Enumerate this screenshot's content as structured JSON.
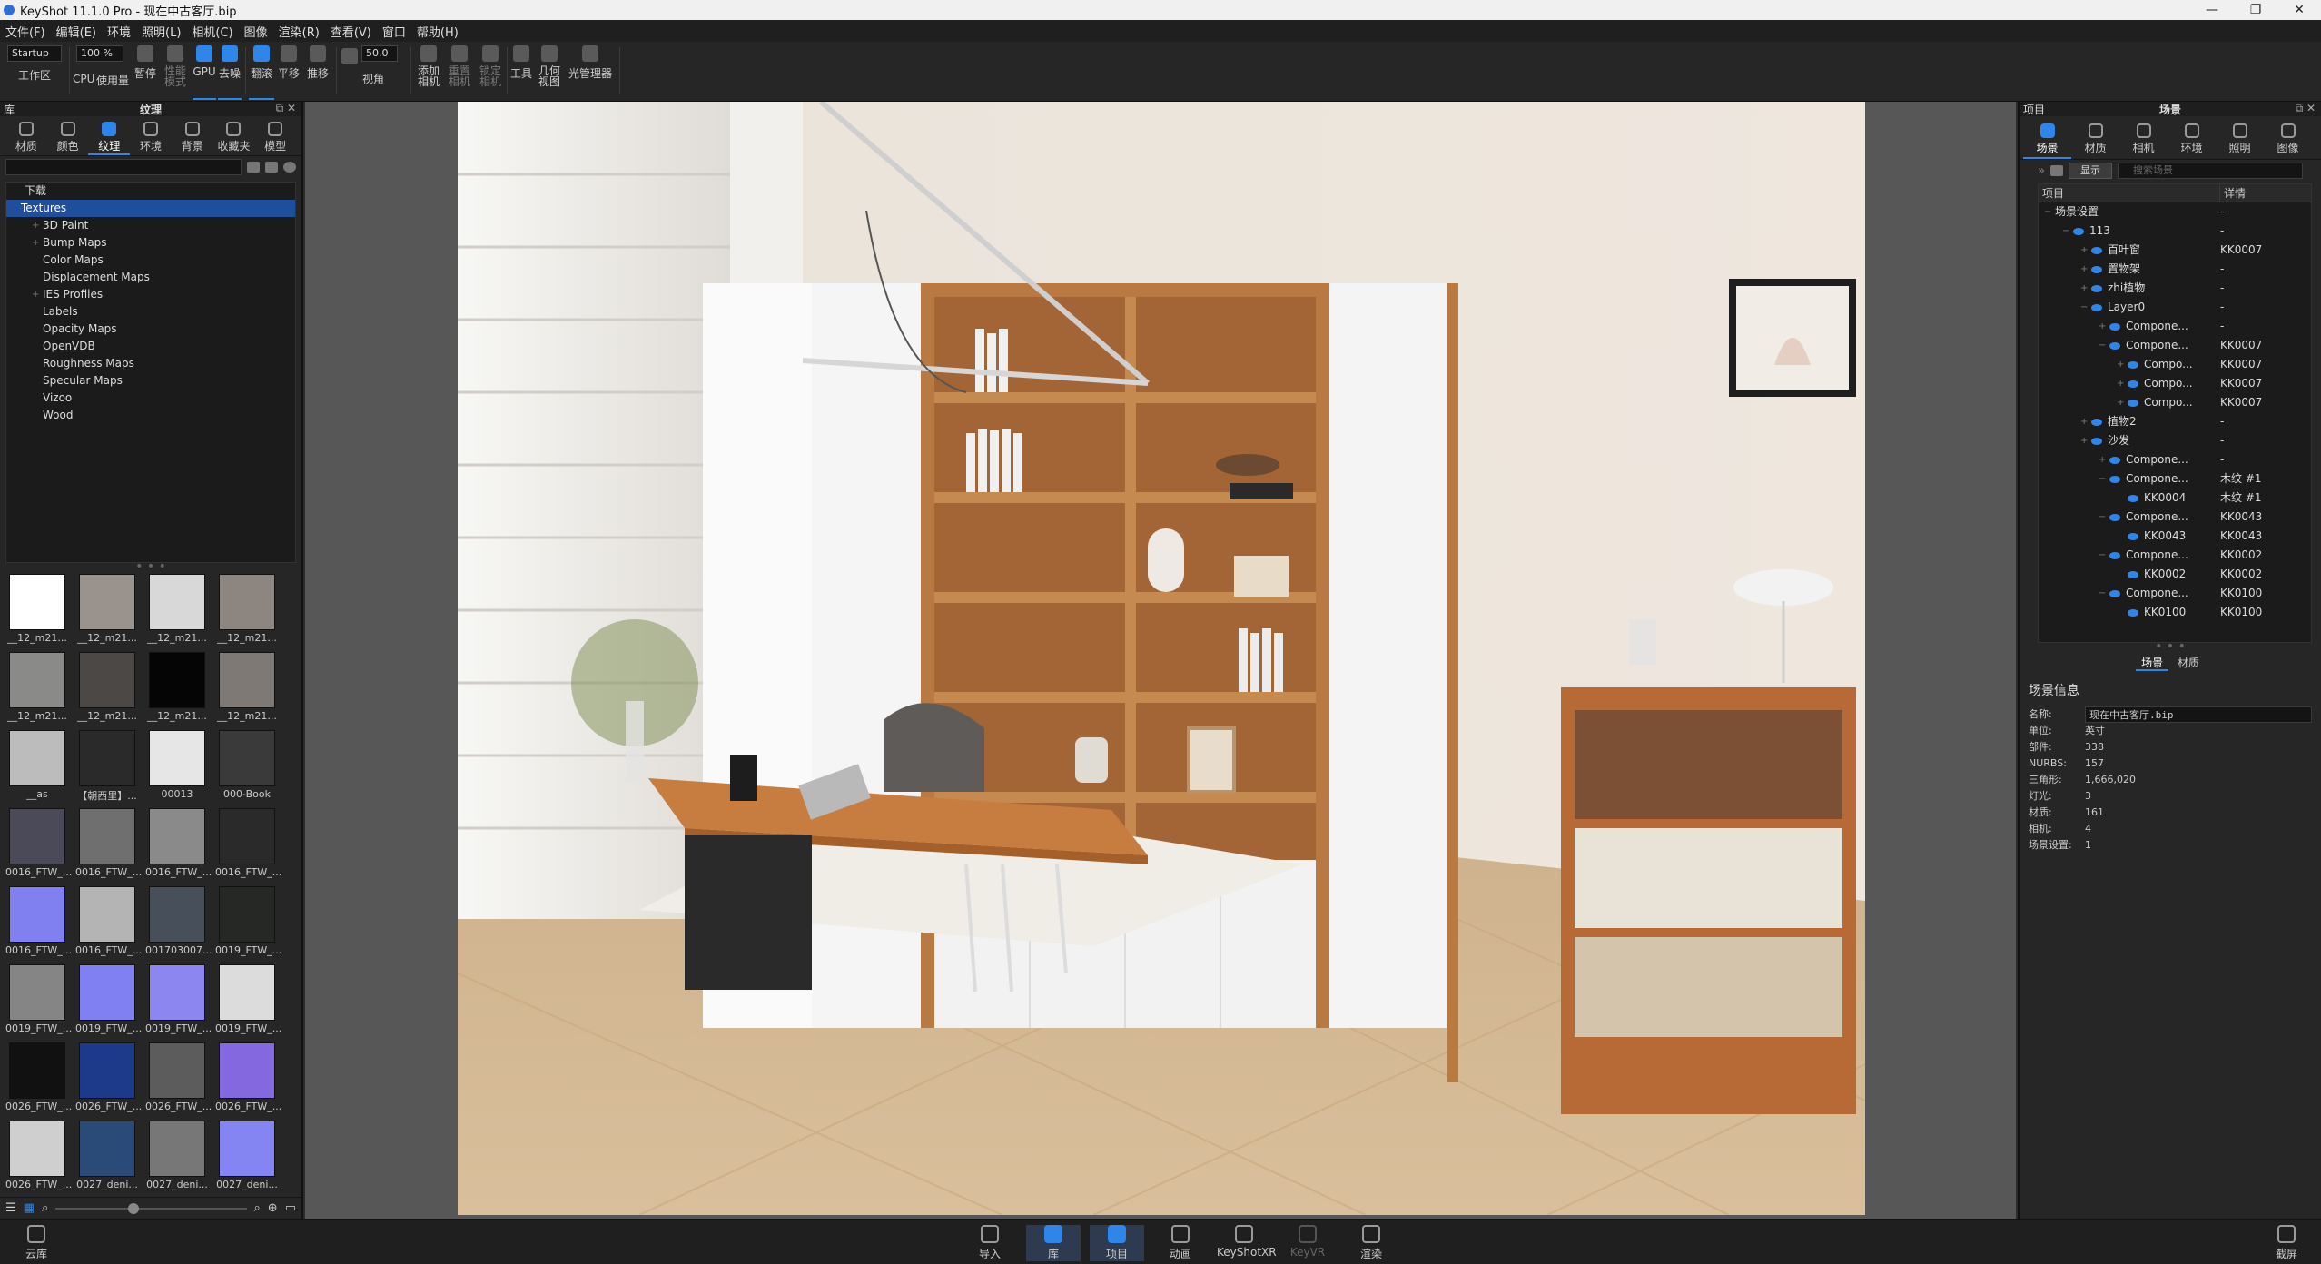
{
  "window": {
    "title": "KeyShot 11.1.0 Pro  - 现在中古客厅.bip",
    "controls": [
      "—",
      "❐",
      "✕"
    ]
  },
  "menu": [
    "文件(F)",
    "编辑(E)",
    "环境",
    "照明(L)",
    "相机(C)",
    "图像",
    "渲染(R)",
    "查看(V)",
    "窗口",
    "帮助(H)"
  ],
  "toolbar": {
    "workspace_value": "Startup",
    "workspace_label": "工作区",
    "zoom_value": "100 %",
    "cpu_label": "CPU",
    "usage_label": "使用量",
    "pause_label": "暂停",
    "perf_label": "性能\n模式",
    "gpu_label": "GPU",
    "denoise_label": "去噪",
    "tumble_label": "翻滚",
    "pan_label": "平移",
    "dolly_label": "推移",
    "fov_value": "50.0",
    "fov_label": "视角",
    "add_camera": "添加\n相机",
    "reset_camera": "重置\n相机",
    "lock_camera": "锁定\n相机",
    "tools": "工具",
    "geometry_view": "几何\n视图",
    "light_manager": "光管理器"
  },
  "left_panel": {
    "header_left": "库",
    "header_center": "纹理",
    "tabs": [
      "材质",
      "颜色",
      "纹理",
      "环境",
      "背景",
      "收藏夹",
      "模型"
    ],
    "active_tab": "纹理",
    "tree": [
      {
        "label": "下载",
        "type": "root"
      },
      {
        "label": "Textures",
        "type": "selected"
      },
      {
        "label": "3D Paint",
        "type": "child",
        "expand": true
      },
      {
        "label": "Bump Maps",
        "type": "child",
        "expand": true
      },
      {
        "label": "Color Maps",
        "type": "child"
      },
      {
        "label": "Displacement Maps",
        "type": "child"
      },
      {
        "label": "IES Profiles",
        "type": "child",
        "expand": true
      },
      {
        "label": "Labels",
        "type": "child"
      },
      {
        "label": "Opacity Maps",
        "type": "child"
      },
      {
        "label": "OpenVDB",
        "type": "child"
      },
      {
        "label": "Roughness Maps",
        "type": "child"
      },
      {
        "label": "Specular Maps",
        "type": "child"
      },
      {
        "label": "Vizoo",
        "type": "child"
      },
      {
        "label": "Wood",
        "type": "child"
      }
    ],
    "thumbnails": [
      {
        "label": "__12_m21...",
        "color": "#ffffff"
      },
      {
        "label": "__12_m21...",
        "color": "#9a938d"
      },
      {
        "label": "__12_m21...",
        "color": "#d8d8d8"
      },
      {
        "label": "__12_m21...",
        "color": "#8d8580"
      },
      {
        "label": "__12_m21...",
        "color": "#8a8a88"
      },
      {
        "label": "__12_m21...",
        "color": "#4b4845"
      },
      {
        "label": "__12_m21...",
        "color": "#050505"
      },
      {
        "label": "__12_m21...",
        "color": "#7e7974"
      },
      {
        "label": "__as",
        "color": "#bcbcbc"
      },
      {
        "label": "【朝西里】...",
        "color": "#2a2a2a"
      },
      {
        "label": "00013",
        "color": "#e6e6e6"
      },
      {
        "label": "000-Book",
        "color": "#3a3a3a"
      },
      {
        "label": "0016_FTW_...",
        "color": "#4a4a58"
      },
      {
        "label": "0016_FTW_...",
        "color": "#6f6f6f"
      },
      {
        "label": "0016_FTW_...",
        "color": "#8a8a8a"
      },
      {
        "label": "0016_FTW_...",
        "color": "#2a2a2a"
      },
      {
        "label": "0016_FTW_...",
        "color": "#8080f0"
      },
      {
        "label": "0016_FTW_...",
        "color": "#b4b4b4"
      },
      {
        "label": "001703007...",
        "color": "#47505a"
      },
      {
        "label": "0019_FTW_...",
        "color": "#262826"
      },
      {
        "label": "0019_FTW_...",
        "color": "#858585"
      },
      {
        "label": "0019_FTW_...",
        "color": "#8080f2"
      },
      {
        "label": "0019_FTW_...",
        "color": "#8c86f0"
      },
      {
        "label": "0019_FTW_...",
        "color": "#dcdcdc"
      },
      {
        "label": "0026_FTW_...",
        "color": "#111111"
      },
      {
        "label": "0026_FTW_...",
        "color": "#1d3a8a"
      },
      {
        "label": "0026_FTW_...",
        "color": "#5c5c5c"
      },
      {
        "label": "0026_FTW_...",
        "color": "#8468e0"
      },
      {
        "label": "0026_FTW_...",
        "color": "#cfcfcf"
      },
      {
        "label": "0027_deni...",
        "color": "#2a4a78"
      },
      {
        "label": "0027_deni...",
        "color": "#777777"
      },
      {
        "label": "0027_deni...",
        "color": "#8484f2"
      }
    ]
  },
  "right_panel": {
    "header_left": "项目",
    "header_center": "场景",
    "tabs": [
      "场景",
      "材质",
      "相机",
      "环境",
      "照明",
      "图像"
    ],
    "active_tab": "场景",
    "show_button": "显示",
    "search_placeholder": "搜索场景",
    "col_item": "项目",
    "col_detail": "详情",
    "tree": [
      {
        "name": "场景设置",
        "detail": "-",
        "indent": 0,
        "toggle": "−",
        "eye": false
      },
      {
        "name": "113",
        "detail": "-",
        "indent": 1,
        "toggle": "−",
        "eye": true
      },
      {
        "name": "百叶窗",
        "detail": "KK0007",
        "indent": 2,
        "toggle": "+",
        "eye": true
      },
      {
        "name": "置物架",
        "detail": "-",
        "indent": 2,
        "toggle": "+",
        "eye": true
      },
      {
        "name": "zhi植物",
        "detail": "-",
        "indent": 2,
        "toggle": "+",
        "eye": true
      },
      {
        "name": "Layer0",
        "detail": "-",
        "indent": 2,
        "toggle": "−",
        "eye": true
      },
      {
        "name": "Compone...",
        "detail": "-",
        "indent": 3,
        "toggle": "+",
        "eye": true
      },
      {
        "name": "Compone...",
        "detail": "KK0007",
        "indent": 3,
        "toggle": "−",
        "eye": true
      },
      {
        "name": "Compo...",
        "detail": "KK0007",
        "indent": 4,
        "toggle": "+",
        "eye": true
      },
      {
        "name": "Compo...",
        "detail": "KK0007",
        "indent": 4,
        "toggle": "+",
        "eye": true
      },
      {
        "name": "Compo...",
        "detail": "KK0007",
        "indent": 4,
        "toggle": "+",
        "eye": true
      },
      {
        "name": "植物2",
        "detail": "-",
        "indent": 2,
        "toggle": "+",
        "eye": true
      },
      {
        "name": "沙发",
        "detail": "-",
        "indent": 2,
        "toggle": "+",
        "eye": true
      },
      {
        "name": "Compone...",
        "detail": "-",
        "indent": 3,
        "toggle": "+",
        "eye": true
      },
      {
        "name": "Compone...",
        "detail": "木纹 #1",
        "indent": 3,
        "toggle": "−",
        "eye": true
      },
      {
        "name": "KK0004",
        "detail": "木纹 #1",
        "indent": 4,
        "toggle": "",
        "eye": true
      },
      {
        "name": "Compone...",
        "detail": "KK0043",
        "indent": 3,
        "toggle": "−",
        "eye": true
      },
      {
        "name": "KK0043",
        "detail": "KK0043",
        "indent": 4,
        "toggle": "",
        "eye": true
      },
      {
        "name": "Compone...",
        "detail": "KK0002",
        "indent": 3,
        "toggle": "−",
        "eye": true
      },
      {
        "name": "KK0002",
        "detail": "KK0002",
        "indent": 4,
        "toggle": "",
        "eye": true
      },
      {
        "name": "Compone...",
        "detail": "KK0100",
        "indent": 3,
        "toggle": "−",
        "eye": true
      },
      {
        "name": "KK0100",
        "detail": "KK0100",
        "indent": 4,
        "toggle": "",
        "eye": true
      }
    ],
    "bottom_tabs": [
      "场景",
      "材质"
    ],
    "info": {
      "title": "场景信息",
      "rows": [
        {
          "k": "名称:",
          "v": "现在中古客厅.bip",
          "box": true
        },
        {
          "k": "单位:",
          "v": "英寸"
        },
        {
          "k": "部件:",
          "v": "338"
        },
        {
          "k": "NURBS:",
          "v": "157"
        },
        {
          "k": "三角形:",
          "v": "1,666,020"
        },
        {
          "k": "灯光:",
          "v": "3"
        },
        {
          "k": "材质:",
          "v": "161"
        },
        {
          "k": "相机:",
          "v": "4"
        },
        {
          "k": "场景设置:",
          "v": "1"
        }
      ]
    }
  },
  "status_bar": {
    "cloud": "云库",
    "buttons": [
      {
        "label": "导入",
        "state": "normal"
      },
      {
        "label": "库",
        "state": "active"
      },
      {
        "label": "项目",
        "state": "active"
      },
      {
        "label": "动画",
        "state": "normal"
      },
      {
        "label": "KeyShotXR",
        "state": "normal"
      },
      {
        "label": "KeyVR",
        "state": "dim"
      },
      {
        "label": "渲染",
        "state": "normal"
      }
    ],
    "screenshot": "截屏"
  }
}
